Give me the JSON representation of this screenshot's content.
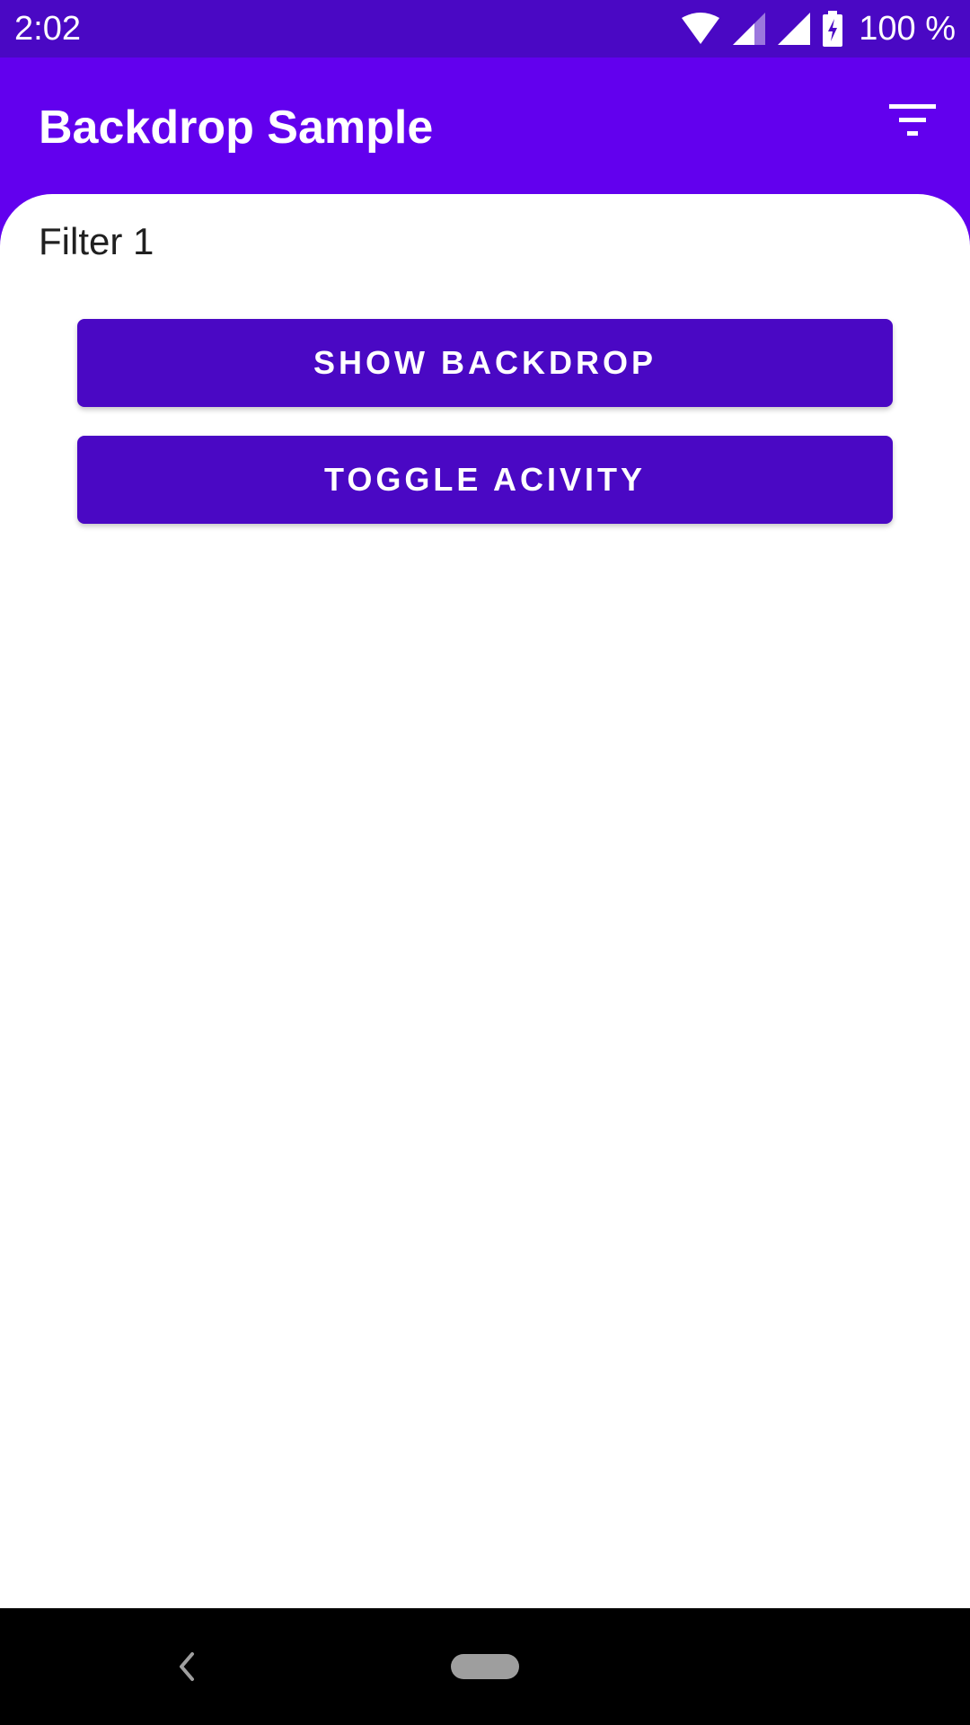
{
  "status_bar": {
    "time": "2:02",
    "battery": "100 %",
    "icons": [
      "wifi-icon",
      "signal-icon",
      "signal-icon",
      "battery-charging-icon"
    ]
  },
  "app_bar": {
    "title": "Backdrop Sample",
    "action_icon": "filter-icon"
  },
  "content": {
    "filter_label": "Filter 1",
    "show_backdrop_label": "SHOW BACKDROP",
    "toggle_activity_label": "TOGGLE ACIVITY"
  },
  "nav_bar": {
    "back_icon": "back-chevron-icon",
    "home_icon": "home-pill-icon"
  },
  "colors": {
    "primary": "#6200EE",
    "primary_dark": "#4A08C4",
    "surface": "#FFFFFF",
    "nav_bar": "#000000"
  }
}
